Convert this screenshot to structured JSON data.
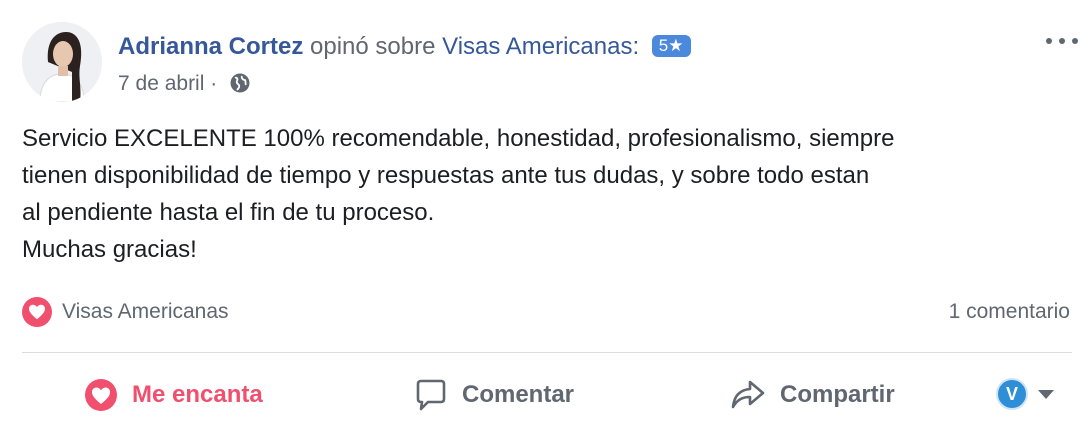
{
  "post": {
    "author": "Adrianna Cortez",
    "verb": "opinó sobre",
    "page_name": "Visas Americanas:",
    "rating": "5★",
    "date": "7 de abril",
    "date_separator": "·",
    "text": "Servicio EXCELENTE 100% recomendable, honestidad, profesionalismo, siempre\ntienen disponibilidad de tiempo y respuestas ante tus dudas, y sobre todo estan\nal pendiente hasta el fin de tu proceso.\nMuchas gracias!"
  },
  "reactions": {
    "reactor": "Visas Americanas",
    "comment_count": "1 comentario"
  },
  "actions": {
    "love_label": "Me encanta",
    "comment_label": "Comentar",
    "share_label": "Compartir",
    "identity_letter": "V"
  },
  "colors": {
    "link": "#365899",
    "love": "#f0506e",
    "rating_badge": "#4a89dc",
    "muted": "#606770"
  },
  "icons": {
    "avatar": "profile-photo",
    "privacy": "globe-icon",
    "more": "more-options-icon",
    "reaction": "heart-icon",
    "comment": "comment-bubble-icon",
    "share": "share-arrow-icon",
    "identity": "page-identity-icon",
    "caret": "chevron-down-icon"
  }
}
